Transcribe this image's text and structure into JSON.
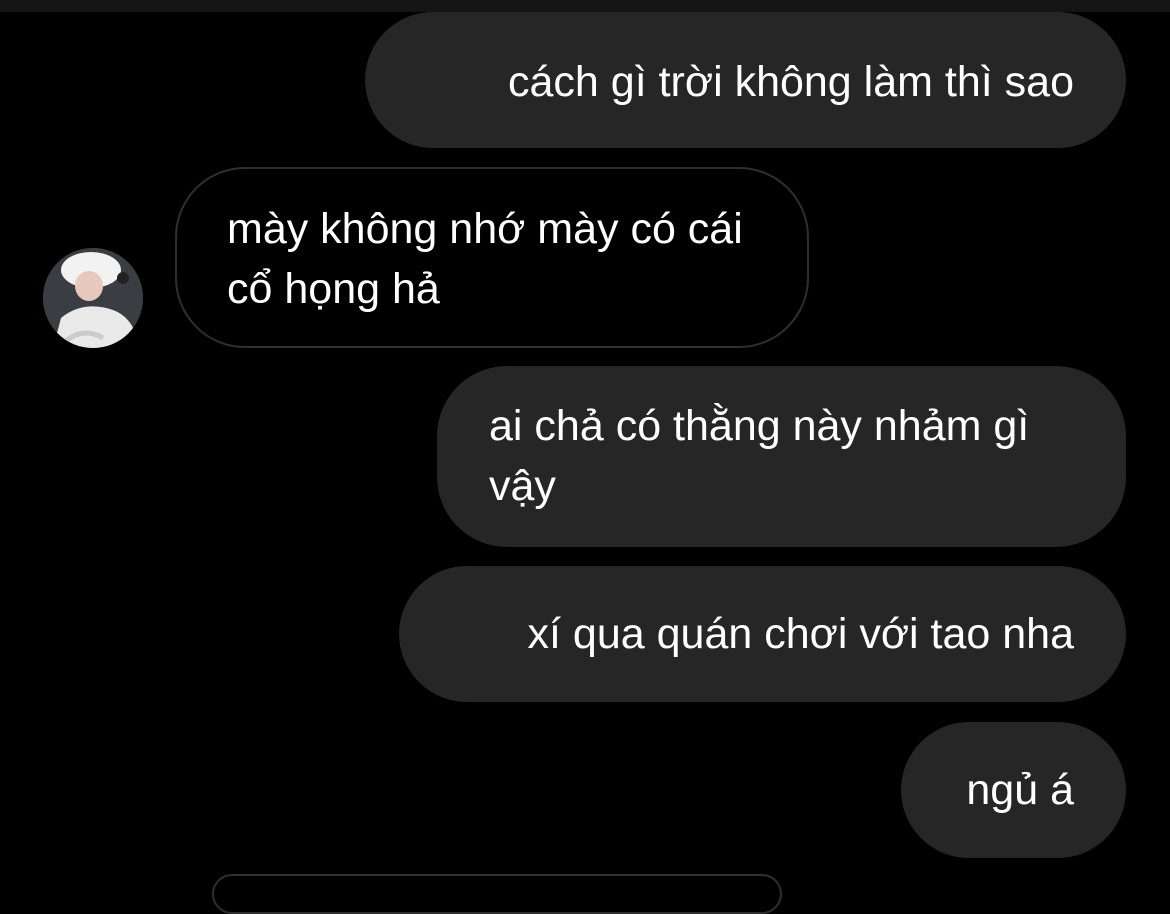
{
  "conversation": {
    "messages": [
      {
        "sender": "me",
        "text": "cách gì trời không làm thì sao"
      },
      {
        "sender": "them",
        "text": "mày không nhớ mày có cái cổ họng hả"
      },
      {
        "sender": "me",
        "text": "ai chả có thằng này nhảm gì vậy"
      },
      {
        "sender": "me",
        "text": "xí qua quán chơi với tao nha"
      },
      {
        "sender": "me",
        "text": "ngủ á"
      },
      {
        "sender": "them",
        "text": ""
      }
    ]
  },
  "colors": {
    "background": "#000000",
    "sent_bubble": "#262626",
    "received_border": "#2f2f2f",
    "text": "#ffffff"
  }
}
